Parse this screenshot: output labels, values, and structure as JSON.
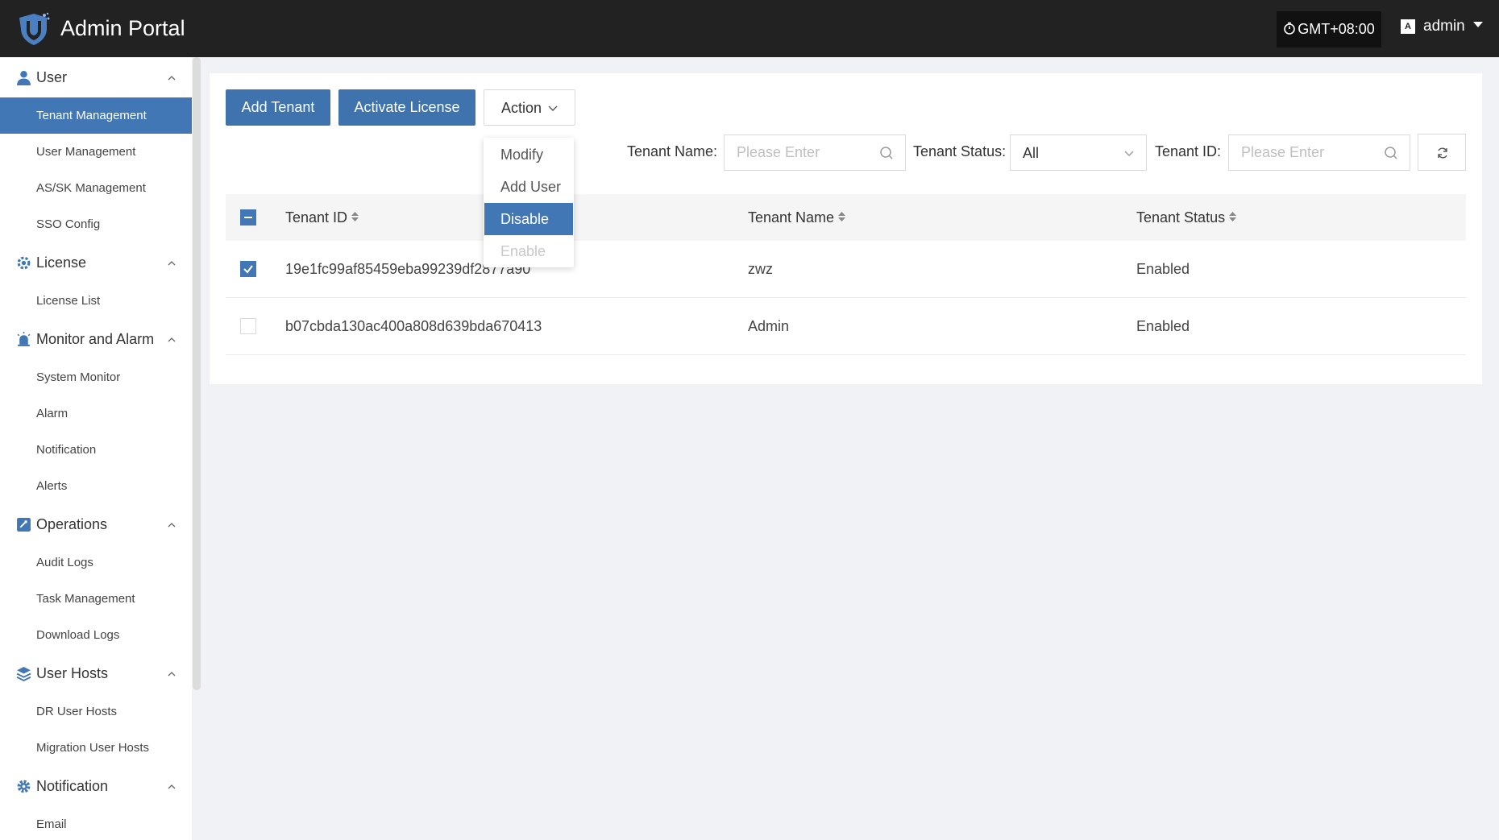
{
  "header": {
    "app_title": "Admin Portal",
    "timezone": "GMT+08:00",
    "username": "admin",
    "colors": {
      "bar": "#222222",
      "accent": "#4277b5"
    }
  },
  "sidebar": {
    "groups": [
      {
        "label": "User",
        "icon": "user-icon",
        "items": [
          "Tenant Management",
          "User Management",
          "AS/SK Management",
          "SSO Config"
        ]
      },
      {
        "label": "License",
        "icon": "license-icon",
        "items": [
          "License List"
        ]
      },
      {
        "label": "Monitor and Alarm",
        "icon": "alarm-icon",
        "items": [
          "System Monitor",
          "Alarm",
          "Notification",
          "Alerts"
        ]
      },
      {
        "label": "Operations",
        "icon": "operations-icon",
        "items": [
          "Audit Logs",
          "Task Management",
          "Download Logs"
        ]
      },
      {
        "label": "User Hosts",
        "icon": "layers-icon",
        "items": [
          "DR User Hosts",
          "Migration User Hosts"
        ]
      },
      {
        "label": "Notification",
        "icon": "gear-icon",
        "items": [
          "Email"
        ]
      }
    ],
    "active_item": "Tenant Management"
  },
  "toolbar": {
    "add_tenant": "Add Tenant",
    "activate_license": "Activate License",
    "action": "Action"
  },
  "action_menu": {
    "items": [
      {
        "label": "Modify",
        "state": "normal"
      },
      {
        "label": "Add User",
        "state": "normal"
      },
      {
        "label": "Disable",
        "state": "highlighted"
      },
      {
        "label": "Enable",
        "state": "disabled"
      }
    ]
  },
  "filters": {
    "tenant_name_label": "Tenant Name:",
    "tenant_name_placeholder": "Please Enter",
    "tenant_status_label": "Tenant Status:",
    "tenant_status_value": "All",
    "tenant_id_label": "Tenant ID:",
    "tenant_id_placeholder": "Please Enter"
  },
  "table": {
    "columns": [
      "Tenant ID",
      "Tenant Name",
      "Tenant Status"
    ],
    "rows": [
      {
        "id": "19e1fc99af85459eba99239df2877a90",
        "name": "zwz",
        "status": "Enabled",
        "checked": true
      },
      {
        "id": "b07cbda130ac400a808d639bda670413",
        "name": "Admin",
        "status": "Enabled",
        "checked": false
      }
    ]
  }
}
